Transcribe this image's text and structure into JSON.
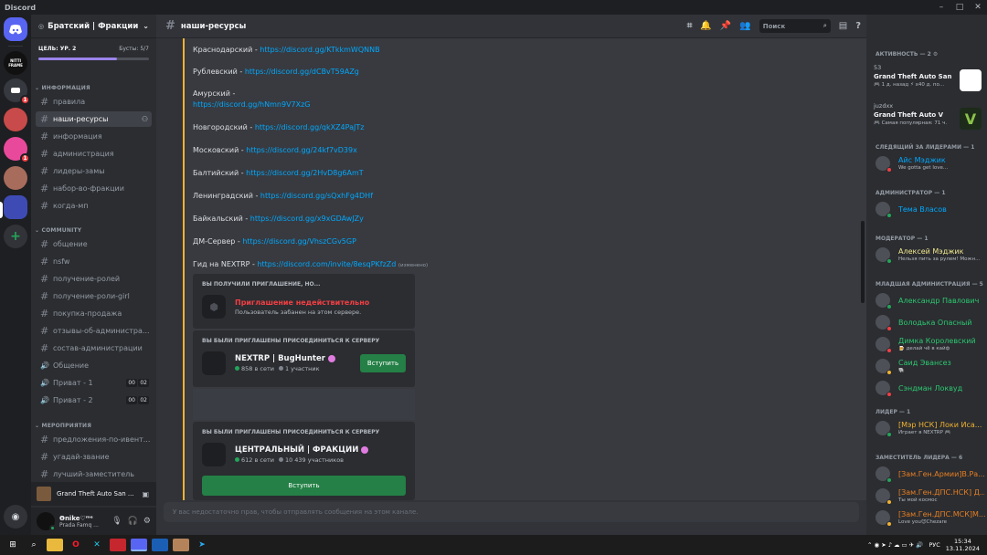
{
  "window": {
    "title": "Discord"
  },
  "guild": {
    "name": "Братский | Фракции",
    "goal": "ЦЕЛЬ: УР. 2",
    "boosts": "Бусты: 5/7",
    "boost_progress": 0.71
  },
  "servers": [
    {
      "label": "",
      "color": "#5865f2",
      "badge": ""
    },
    {
      "label": "NITTI FRAME",
      "color": "#111111",
      "badge": ""
    },
    {
      "label": "",
      "color": "#36393f",
      "badge": "1"
    },
    {
      "label": "",
      "color": "#c94a4a",
      "badge": ""
    },
    {
      "label": "",
      "color": "#e9499b",
      "badge": "1"
    },
    {
      "label": "",
      "color": "#a86c5c",
      "badge": ""
    },
    {
      "label": "",
      "color": "#3f4bb5",
      "badge": ""
    }
  ],
  "categories": {
    "info": "ИНФОРМАЦИЯ",
    "community": "COMMUNITY",
    "events": "МЕРОПРИЯТИЯ"
  },
  "channels_info": [
    "правила",
    "наши-ресурсы",
    "информация",
    "администрация",
    "лидеры-замы",
    "набор-во-фракции",
    "когда-мп"
  ],
  "channels_community": [
    "общение",
    "nsfw",
    "получение-ролей",
    "получение-роли-girl",
    "покупка-продажа",
    "отзывы-об-администра...",
    "состав-администрации"
  ],
  "voice_channels": [
    {
      "name": "Общение",
      "c1": "",
      "c2": ""
    },
    {
      "name": "Приват - 1",
      "c1": "00",
      "c2": "02"
    },
    {
      "name": "Приват - 2",
      "c1": "00",
      "c2": "02"
    }
  ],
  "channels_events": [
    "предложения-по-ивент...",
    "угадай-звание",
    "лучший-заместитель"
  ],
  "activity_bar": {
    "game": "Grand Theft Auto San ..."
  },
  "user": {
    "name": "Ѳnike♡ᵐᵉ",
    "status": "Prada Famq ..."
  },
  "channel": {
    "name": "наши-ресурсы",
    "search_placeholder": "Поиск"
  },
  "messages": [
    {
      "text": "Краснодарский - ",
      "link": "https://discord.gg/KTkkmWQNNB"
    },
    {
      "text": "Рублевский - ",
      "link": "https://discord.gg/dCBvT59AZg"
    },
    {
      "text": "Амурский -",
      "link": ""
    },
    {
      "text": "",
      "link": "https://discord.gg/hNmn9V7XzG"
    },
    {
      "text": "Новгородский - ",
      "link": "https://discord.gg/qkXZ4PaJTz"
    },
    {
      "text": "Московский - ",
      "link": "https://discord.gg/24kf7vD39x"
    },
    {
      "text": "Балтийский - ",
      "link": "https://discord.gg/2HvD8g6AmT"
    },
    {
      "text": "Ленинградский - ",
      "link": "https://discord.gg/sQxhFg4DHf"
    },
    {
      "text": "Байкальский - ",
      "link": "https://discord.gg/x9xGDAwJZy"
    },
    {
      "text": "ДМ-Сервер - ",
      "link": "https://discord.gg/VhszCGv5GP"
    },
    {
      "text": "Гид на NEXTRP - ",
      "link": "https://discord.com/invite/8esqPKfzZd",
      "edited": "(изменено)"
    }
  ],
  "invites": [
    {
      "heading": "ВЫ ПОЛУЧИЛИ ПРИГЛАШЕНИЕ, НО...",
      "error": "Приглашение недействительно",
      "detail": "Пользователь забанен на этом сервере."
    },
    {
      "heading": "ВЫ БЫЛИ ПРИГЛАШЕНЫ ПРИСОЕДИНИТЬСЯ К СЕРВЕРУ",
      "name": "NEXTRP | BugHunter",
      "online": "858 в сети",
      "members": "1 участник",
      "button": "Вступить"
    },
    {
      "heading": "ВЫ БЫЛИ ПРИГЛАШЕНЫ ПРИСОЕДИНИТЬСЯ К СЕРВЕРУ",
      "name": "ЦЕНТРАЛЬНЫЙ | ФРАКЦИИ",
      "online": "612 в сети",
      "members": "10 439 участников",
      "button": "Вступить"
    }
  ],
  "composer": {
    "placeholder": "У вас недостаточно прав, чтобы отправлять сообщения на этом канале."
  },
  "member_panel": {
    "activity_heading": "АКТИВНОСТЬ — 2",
    "activities": [
      {
        "who": "53",
        "game": "Grand Theft Auto San ...",
        "meta": "🎮 1 д. назад  ⚡ х40 д. по..."
      },
      {
        "who": "juzdxx",
        "game": "Grand Theft Auto V",
        "meta": "🎮 Самая популярная: 71 ч."
      }
    ],
    "groups": [
      {
        "title": "СЛЕДЯЩИЙ ЗА ЛИДЕРАМИ — 1",
        "members": [
          {
            "name": "Айс Мэджик",
            "sub": "We gotta get love...",
            "color": "#00a8fc",
            "status": "#f23f43"
          }
        ]
      },
      {
        "title": "АДМИНИСТРАТОР — 1",
        "members": [
          {
            "name": "Тема Власов",
            "sub": "",
            "color": "#00a8fc",
            "status": "#23a55a"
          }
        ]
      },
      {
        "title": "МОДЕРАТОР — 1",
        "members": [
          {
            "name": "Алексей Мэджик",
            "sub": "Нельзя пить за рулем! Можн...",
            "color": "#f0e68c",
            "status": "#23a55a"
          }
        ]
      },
      {
        "title": "МЛАДШАЯ АДМИНИСТРАЦИЯ — 5",
        "members": [
          {
            "name": "Александр Павлович",
            "sub": "",
            "color": "#2dc770",
            "status": "#23a55a"
          },
          {
            "name": "Володька Опасный",
            "sub": "",
            "color": "#2dc770",
            "status": "#f23f43"
          },
          {
            "name": "Димка Королевский",
            "sub": "🍺 делай чё в кайф",
            "color": "#2dc770",
            "status": "#f23f43"
          },
          {
            "name": "Саид Эвансез",
            "sub": "🐘",
            "color": "#2dc770",
            "status": "#f0b232"
          },
          {
            "name": "Сэндман Локвуд",
            "sub": "",
            "color": "#2dc770",
            "status": "#f23f43"
          }
        ]
      },
      {
        "title": "ЛИДЕР — 1",
        "members": [
          {
            "name": "[Мэр НСК] Локи Иса...",
            "sub": "Играет в NEXTRP 🎮",
            "color": "#f0b232",
            "status": "#23a55a"
          }
        ]
      },
      {
        "title": "ЗАМЕСТИТЕЛЬ ЛИДЕРА — 6",
        "members": [
          {
            "name": "[Зам.Ген.Армии]В.Ра...",
            "sub": "",
            "color": "#e67e22",
            "status": "#23a55a"
          },
          {
            "name": "[Зам.Ген.ДПС.НСК] Д...",
            "sub": "Ты мой космос",
            "color": "#e67e22",
            "status": "#f0b232"
          },
          {
            "name": "[Зам.Ген.ДПС.МСК]М...",
            "sub": "Love you😈Chezare",
            "color": "#e67e22",
            "status": "#f0b232"
          }
        ]
      }
    ]
  },
  "taskbar": {
    "lang": "РУС",
    "time": "15:34",
    "date": "13.11.2024"
  }
}
